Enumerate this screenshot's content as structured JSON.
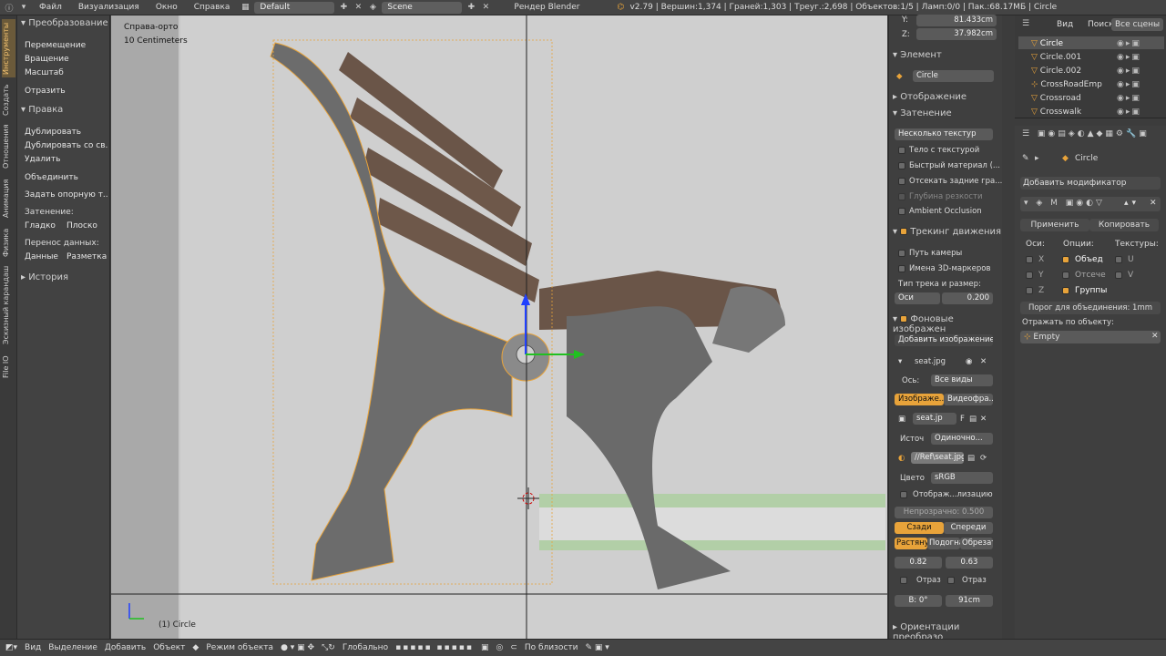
{
  "topbar": {
    "menus": [
      "Файл",
      "Визуализация",
      "Окно",
      "Справка"
    ],
    "layout": "Default",
    "scene": "Scene",
    "engine": "Рендер Blender",
    "stats": "v2.79 | Вершин:1,374 | Граней:1,303 | Треуг.:2,698 | Объектов:1/5 | Ламп:0/0 | Пак.:68.17MБ | Circle"
  },
  "left_tabs": [
    "Инструменты",
    "Создать",
    "Отношения",
    "Анимация",
    "Физика",
    "Эскизный карандаш",
    "File IO"
  ],
  "tools": {
    "transform_header": "Преобразование",
    "transform": [
      "Перемещение",
      "Вращение",
      "Масштаб"
    ],
    "mirror": "Отразить",
    "edit_header": "Правка",
    "edit": [
      "Дублировать",
      "Дублировать со св...",
      "Удалить"
    ],
    "join": "Объединить",
    "origin": "Задать опорную т...",
    "shading_label": "Затенение:",
    "smooth": "Гладко",
    "flat": "Плоско",
    "data_transfer_label": "Перенос данных:",
    "data": "Данные",
    "layout": "Разметка",
    "history_header": "История"
  },
  "viewport": {
    "view_name": "Справа-орто",
    "scale": "10 Centimeters",
    "object_label": "(1) Circle"
  },
  "npanel": {
    "y_label": "Y:",
    "y_value": "81.433cm",
    "z_label": "Z:",
    "z_value": "37.982cm",
    "item_header": "Элемент",
    "item_name": "Circle",
    "display_header": "Отображение",
    "shading_header": "Затенение",
    "shading_mode": "Несколько текстур",
    "textured_solid": "Тело с текстурой",
    "matcap": "Быстрый материал (...",
    "backface": "Отсекать задние гра...",
    "dof": "Глубина резкости",
    "ao": "Ambient Occlusion",
    "tracking_header": "Трекинг движения",
    "camera_path": "Путь камеры",
    "marker_names": "Имена 3D-маркеров",
    "track_type": "Тип трека и размер:",
    "axes": "Оси",
    "axes_size": "0.200",
    "bg_header": "Фоновые изображен",
    "add_image": "Добавить изображение",
    "image_name": "seat.jpg",
    "axis_label": "Ось:",
    "axis_value": "Все виды",
    "tab_image": "Изображе...",
    "tab_video": "Видеофра...",
    "img_field": "seat.jp",
    "img_f": "F",
    "source_label": "Источ",
    "source_value": "Одиночно...",
    "path": "//Ref\\seat.jpg",
    "color_label": "Цвето",
    "color_value": "sRGB",
    "display_opt": "Отображ...лизацию",
    "opacity": "Непрозрачно: 0.500",
    "back": "Сзади",
    "front": "Спереди",
    "stretch": "Растяну",
    "fit": "Подогна",
    "crop": "Обрезат",
    "x_off": "0.82",
    "y_off": "0.63",
    "flip1": "Отраз",
    "flip2": "Отраз",
    "rot": "В: 0°",
    "size": "91cm",
    "transform_header": "Ориентации преобразо"
  },
  "outliner": {
    "tabs": [
      "Вид",
      "Поиск",
      "Все сцены"
    ],
    "items": [
      "Circle",
      "Circle.001",
      "Circle.002",
      "CrossRoadEmp",
      "Crossroad",
      "Crosswalk"
    ]
  },
  "props": {
    "object_name": "Circle",
    "add_modifier": "Добавить модификатор",
    "apply": "Применить",
    "copy": "Копировать",
    "axes_label": "Оси:",
    "options_label": "Опции:",
    "textures_label": "Текстуры:",
    "x": "X",
    "y": "Y",
    "z": "Z",
    "merge": "Объед",
    "clip": "Отсече",
    "groups": "Группы",
    "u": "U",
    "v": "V",
    "merge_limit": "Порог для объединения: 1mm",
    "mirror_object_label": "Отражать по объекту:",
    "mirror_object": "Empty"
  },
  "bottom": {
    "items": [
      "Вид",
      "Выделение",
      "Добавить",
      "Объект"
    ],
    "mode": "Режим объекта",
    "orientation": "Глобально",
    "snap": "По близости"
  },
  "colors": {
    "accent": "#e8a33a",
    "viewport_bg": "#c7c7c7",
    "panel": "#3f3f3f"
  }
}
